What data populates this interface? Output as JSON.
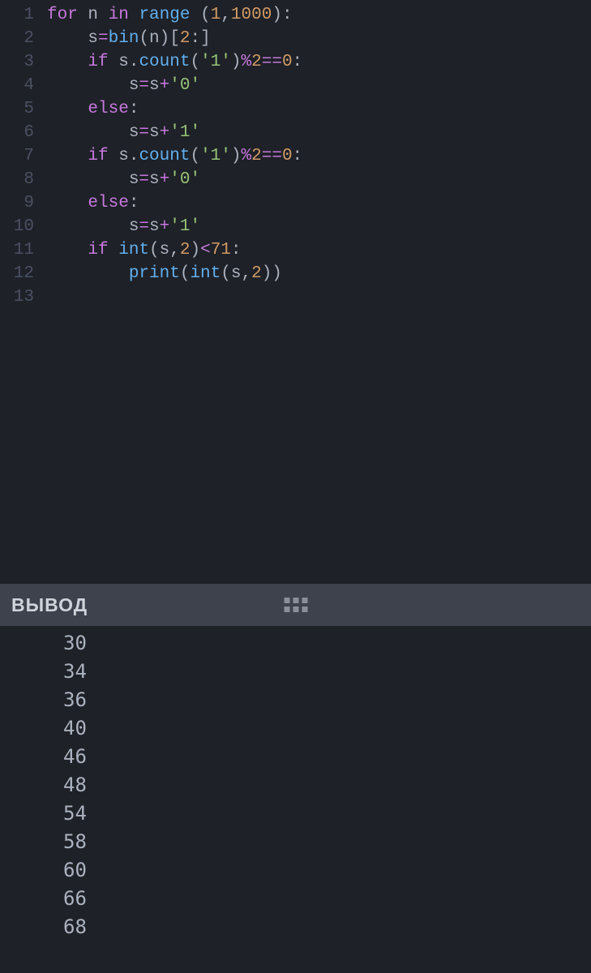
{
  "editor": {
    "line_numbers": [
      "1",
      "2",
      "3",
      "4",
      "5",
      "6",
      "7",
      "8",
      "9",
      "10",
      "11",
      "12",
      "13"
    ],
    "lines": [
      [
        {
          "t": "for ",
          "c": "tok-kw"
        },
        {
          "t": "n ",
          "c": "tok-id"
        },
        {
          "t": "in ",
          "c": "tok-kw"
        },
        {
          "t": "range ",
          "c": "tok-call"
        },
        {
          "t": "(",
          "c": "tok-punc"
        },
        {
          "t": "1",
          "c": "tok-num"
        },
        {
          "t": ",",
          "c": "tok-punc"
        },
        {
          "t": "1000",
          "c": "tok-num"
        },
        {
          "t": ")",
          "c": "tok-punc"
        },
        {
          "t": ":",
          "c": "tok-punc"
        }
      ],
      [
        {
          "t": "    s",
          "c": "tok-id"
        },
        {
          "t": "=",
          "c": "tok-op"
        },
        {
          "t": "bin",
          "c": "tok-call"
        },
        {
          "t": "(n)[",
          "c": "tok-punc"
        },
        {
          "t": "2",
          "c": "tok-num"
        },
        {
          "t": ":]",
          "c": "tok-punc"
        }
      ],
      [
        {
          "t": "    ",
          "c": ""
        },
        {
          "t": "if ",
          "c": "tok-kw"
        },
        {
          "t": "s.",
          "c": "tok-id"
        },
        {
          "t": "count",
          "c": "tok-call"
        },
        {
          "t": "(",
          "c": "tok-punc"
        },
        {
          "t": "'1'",
          "c": "tok-str"
        },
        {
          "t": ")",
          "c": "tok-punc"
        },
        {
          "t": "%",
          "c": "tok-op"
        },
        {
          "t": "2",
          "c": "tok-num"
        },
        {
          "t": "==",
          "c": "tok-op"
        },
        {
          "t": "0",
          "c": "tok-num"
        },
        {
          "t": ":",
          "c": "tok-punc"
        }
      ],
      [
        {
          "t": "        s",
          "c": "tok-id"
        },
        {
          "t": "=",
          "c": "tok-op"
        },
        {
          "t": "s",
          "c": "tok-id"
        },
        {
          "t": "+",
          "c": "tok-op"
        },
        {
          "t": "'0'",
          "c": "tok-str"
        }
      ],
      [
        {
          "t": "    ",
          "c": ""
        },
        {
          "t": "else",
          "c": "tok-kw"
        },
        {
          "t": ":",
          "c": "tok-punc"
        }
      ],
      [
        {
          "t": "        s",
          "c": "tok-id"
        },
        {
          "t": "=",
          "c": "tok-op"
        },
        {
          "t": "s",
          "c": "tok-id"
        },
        {
          "t": "+",
          "c": "tok-op"
        },
        {
          "t": "'1'",
          "c": "tok-str"
        }
      ],
      [
        {
          "t": "    ",
          "c": ""
        },
        {
          "t": "if ",
          "c": "tok-kw"
        },
        {
          "t": "s.",
          "c": "tok-id"
        },
        {
          "t": "count",
          "c": "tok-call"
        },
        {
          "t": "(",
          "c": "tok-punc"
        },
        {
          "t": "'1'",
          "c": "tok-str"
        },
        {
          "t": ")",
          "c": "tok-punc"
        },
        {
          "t": "%",
          "c": "tok-op"
        },
        {
          "t": "2",
          "c": "tok-num"
        },
        {
          "t": "==",
          "c": "tok-op"
        },
        {
          "t": "0",
          "c": "tok-num"
        },
        {
          "t": ":",
          "c": "tok-punc"
        }
      ],
      [
        {
          "t": "        s",
          "c": "tok-id"
        },
        {
          "t": "=",
          "c": "tok-op"
        },
        {
          "t": "s",
          "c": "tok-id"
        },
        {
          "t": "+",
          "c": "tok-op"
        },
        {
          "t": "'0'",
          "c": "tok-str"
        }
      ],
      [
        {
          "t": "    ",
          "c": ""
        },
        {
          "t": "else",
          "c": "tok-kw"
        },
        {
          "t": ":",
          "c": "tok-punc"
        }
      ],
      [
        {
          "t": "        s",
          "c": "tok-id"
        },
        {
          "t": "=",
          "c": "tok-op"
        },
        {
          "t": "s",
          "c": "tok-id"
        },
        {
          "t": "+",
          "c": "tok-op"
        },
        {
          "t": "'1'",
          "c": "tok-str"
        }
      ],
      [
        {
          "t": "    ",
          "c": ""
        },
        {
          "t": "if ",
          "c": "tok-kw"
        },
        {
          "t": "int",
          "c": "tok-call"
        },
        {
          "t": "(s,",
          "c": "tok-punc"
        },
        {
          "t": "2",
          "c": "tok-num"
        },
        {
          "t": ")",
          "c": "tok-punc"
        },
        {
          "t": "<",
          "c": "tok-op"
        },
        {
          "t": "71",
          "c": "tok-num"
        },
        {
          "t": ":",
          "c": "tok-punc"
        }
      ],
      [
        {
          "t": "        ",
          "c": ""
        },
        {
          "t": "print",
          "c": "tok-call"
        },
        {
          "t": "(",
          "c": "tok-punc"
        },
        {
          "t": "int",
          "c": "tok-call"
        },
        {
          "t": "(s,",
          "c": "tok-punc"
        },
        {
          "t": "2",
          "c": "tok-num"
        },
        {
          "t": "))",
          "c": "tok-punc"
        }
      ],
      []
    ]
  },
  "panel": {
    "title": "ВЫВОД"
  },
  "output": {
    "lines": [
      "30",
      "34",
      "36",
      "40",
      "46",
      "48",
      "54",
      "58",
      "60",
      "66",
      "68"
    ]
  }
}
